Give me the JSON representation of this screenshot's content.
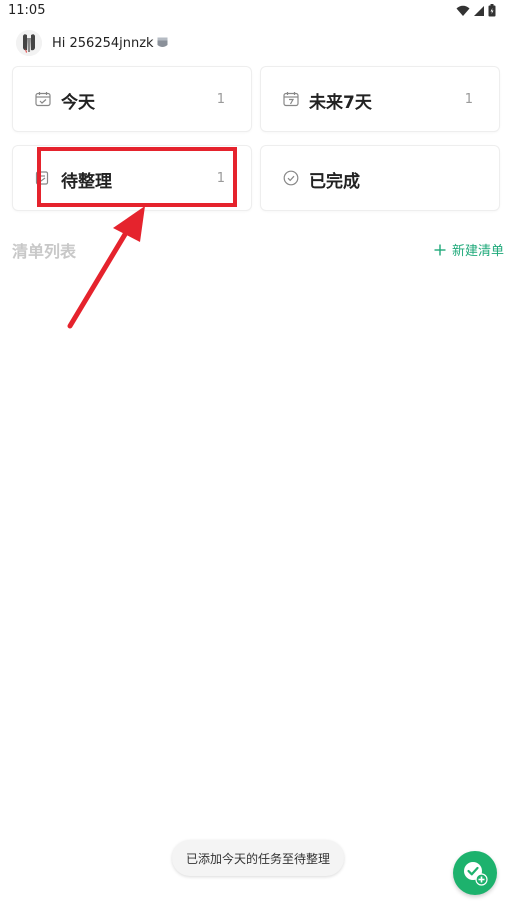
{
  "status_bar": {
    "time": "11:05",
    "icons": [
      "wifi-icon",
      "signal-icon",
      "battery-icon"
    ]
  },
  "header": {
    "greeting": "Hi 256254jnnzk",
    "avatar": "avatar",
    "badge_icon": "card-badge-icon"
  },
  "cards": {
    "today": {
      "label": "今天",
      "count": "1",
      "icon": "calendar-check-icon"
    },
    "future": {
      "label": "未来7天",
      "count": "1",
      "icon": "calendar-7-icon"
    },
    "inbox": {
      "label": "待整理",
      "count": "1",
      "icon": "inbox-icon"
    },
    "done": {
      "label": "已完成",
      "count": "",
      "icon": "check-circle-icon"
    }
  },
  "lists": {
    "title": "清单列表",
    "new_list_label": "新建清单"
  },
  "toast": {
    "message": "已添加今天的任务至待整理"
  },
  "fab": {
    "icon": "add-task-icon"
  },
  "colors": {
    "accent_green": "#1fa97a",
    "fab_green": "#1db26d",
    "highlight_red": "#e5232d",
    "muted_text": "#c8c8c8"
  }
}
